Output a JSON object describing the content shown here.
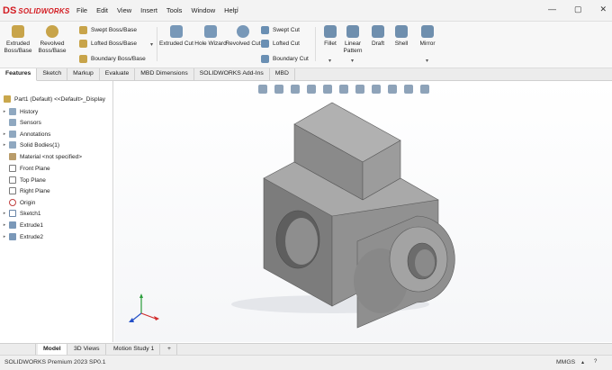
{
  "app": {
    "brand_mark": "DS",
    "brand_name": "SOLIDWORKS"
  },
  "menu": [
    "File",
    "Edit",
    "View",
    "Insert",
    "Tools",
    "Window",
    "Help"
  ],
  "window_controls": [
    "—",
    "▢",
    "✕"
  ],
  "ribbon": {
    "extruded_boss": "Extruded Boss/Base",
    "revolved_boss": "Revolved Boss/Base",
    "swept_boss": "Swept Boss/Base",
    "lofted_boss": "Lofted Boss/Base",
    "boundary_boss": "Boundary Boss/Base",
    "extruded_cut": "Extruded Cut",
    "hole_wizard": "Hole Wizard",
    "revolved_cut": "Revolved Cut",
    "swept_cut": "Swept Cut",
    "lofted_cut": "Lofted Cut",
    "boundary_cut": "Boundary Cut",
    "fillet": "Fillet",
    "linear_pattern": "Linear Pattern",
    "draft": "Draft",
    "shell": "Shell",
    "mirror": "Mirror"
  },
  "tabs": [
    "Features",
    "Sketch",
    "Markup",
    "Evaluate",
    "MBD Dimensions",
    "SOLIDWORKS Add-Ins",
    "MBD"
  ],
  "tree": {
    "root": "Part1  (Default)  <<Default>_Display",
    "items": [
      "History",
      "Sensors",
      "Annotations",
      "Solid Bodies(1)",
      "Material <not specified>",
      "Front Plane",
      "Top Plane",
      "Right Plane",
      "Origin",
      "Sketch1",
      "Extrude1",
      "Extrude2"
    ]
  },
  "bottom_tabs": [
    "Model",
    "3D Views",
    "Motion Study 1",
    "+"
  ],
  "status": {
    "left": "SOLIDWORKS Premium 2023 SP0.1",
    "units": "MMGS"
  },
  "colors": {
    "brand_red": "#d31b21",
    "model_top": "#a9a9a9",
    "model_left": "#7c7c7c",
    "model_right": "#909090"
  }
}
